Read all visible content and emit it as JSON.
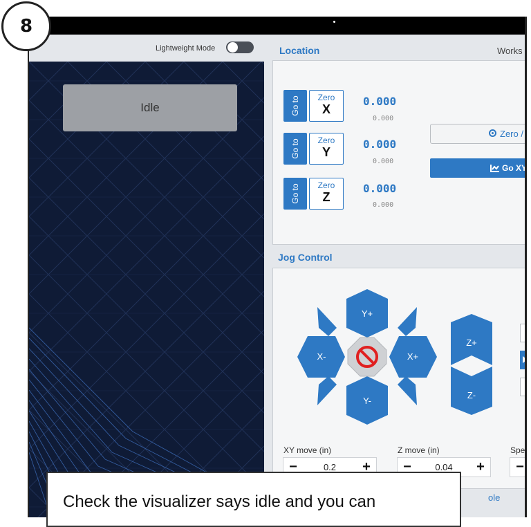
{
  "step_badge": "8",
  "header": {
    "lightweight_mode_label": "Lightweight Mode"
  },
  "visualizer": {
    "status": "Idle"
  },
  "location": {
    "title": "Location",
    "workspace_label": "Works",
    "axes": [
      {
        "goto_label": "Go to",
        "zero_label": "Zero",
        "axis": "X",
        "work_value": "0.000",
        "machine_value": "0.000"
      },
      {
        "goto_label": "Go to",
        "zero_label": "Zero",
        "axis": "Y",
        "work_value": "0.000",
        "machine_value": "0.000"
      },
      {
        "goto_label": "Go to",
        "zero_label": "Zero",
        "axis": "Z",
        "work_value": "0.000",
        "machine_value": "0.000"
      }
    ],
    "zero_all_label": "Zero /",
    "go_xy_label": "Go XY"
  },
  "jog": {
    "title": "Jog Control",
    "buttons": {
      "y_plus": "Y+",
      "y_minus": "Y-",
      "x_plus": "X+",
      "x_minus": "X-",
      "z_plus": "Z+",
      "z_minus": "Z-"
    },
    "xy_move": {
      "label": "XY move (in)",
      "value": "0.2"
    },
    "z_move": {
      "label": "Z move (in)",
      "value": "0.04"
    },
    "speed": {
      "label": "Spe"
    },
    "minus_glyph": "−",
    "plus_glyph": "+"
  },
  "console_tab": "ole",
  "tooltip": "Check the visualizer says idle and you can",
  "colors": {
    "accent": "#2e79c4",
    "visualizer_bg": "#0f1b36",
    "stop": "#e02020"
  }
}
